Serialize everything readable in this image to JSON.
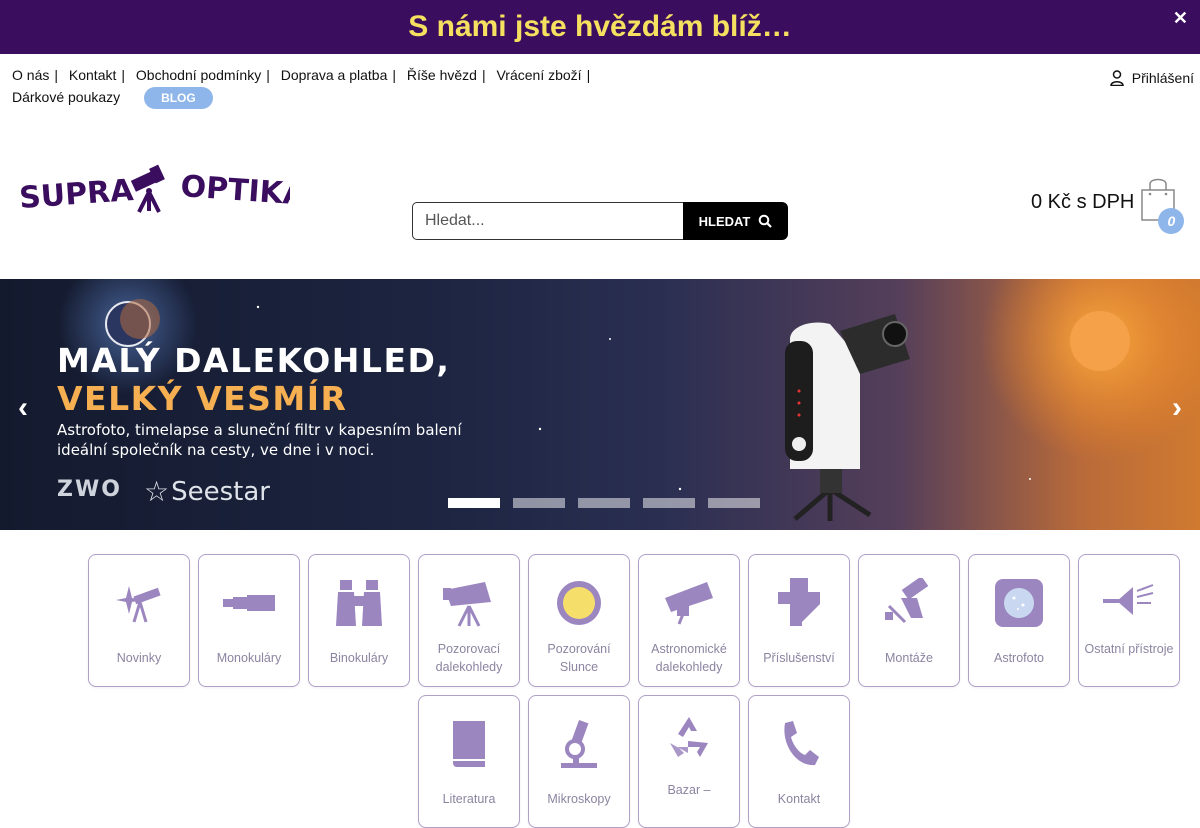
{
  "topbar": {
    "text": "S námi jste hvězdám blíž…",
    "close": "✕"
  },
  "nav": {
    "items": [
      "O nás",
      "Kontakt",
      "Obchodní podmínky",
      "Doprava a platba",
      "Říše hvězd",
      "Vrácení zboží",
      "Dárkové poukazy"
    ],
    "blog": "BLOG"
  },
  "login": {
    "label": "Přihlášení"
  },
  "logo": {
    "left": "SUPRA",
    "right": "OPTIKA"
  },
  "search": {
    "placeholder": "Hledat...",
    "button": "HLEDAT"
  },
  "cart": {
    "price": "0 Kč s DPH",
    "count": "0"
  },
  "banner": {
    "headline1": "MALÝ DALEKOHLED,",
    "headline2": "VELKÝ VESMÍR",
    "subtitle": "Astrofoto, timelapse a sluneční filtr v kapesním balení ideální společník na cesty, ve dne i v noci.",
    "brand1": "ZWO",
    "brand2": "Seestar",
    "slides": 5,
    "active_slide": 1
  },
  "categories": [
    {
      "label": "Novinky",
      "icon": "telescope-star-icon"
    },
    {
      "label": "Monokuláry",
      "icon": "monocular-icon"
    },
    {
      "label": "Binokuláry",
      "icon": "binoculars-icon"
    },
    {
      "label": "Pozorovací dalekohledy",
      "icon": "spotting-scope-icon"
    },
    {
      "label": "Pozorování Slunce",
      "icon": "sun-icon"
    },
    {
      "label": "Astronomické dalekohledy",
      "icon": "astro-telescope-icon"
    },
    {
      "label": "Příslušenství",
      "icon": "diagonal-accessory-icon"
    },
    {
      "label": "Montáže",
      "icon": "mount-icon"
    },
    {
      "label": "Astrofoto",
      "icon": "astrophoto-icon"
    },
    {
      "label": "Ostatní přístroje",
      "icon": "other-instruments-icon"
    },
    {
      "label": "Literatura",
      "icon": "book-icon"
    },
    {
      "label": "Mikroskopy",
      "icon": "microscope-icon"
    },
    {
      "label": "Bazar –",
      "icon": "recycle-icon"
    },
    {
      "label": "Kontakt",
      "icon": "phone-icon"
    }
  ],
  "colors": {
    "brand_purple": "#3a0d5e",
    "topbar_text": "#f5e060",
    "accent_blue": "#8fb6ea",
    "icon_purple": "#9b86c0"
  }
}
